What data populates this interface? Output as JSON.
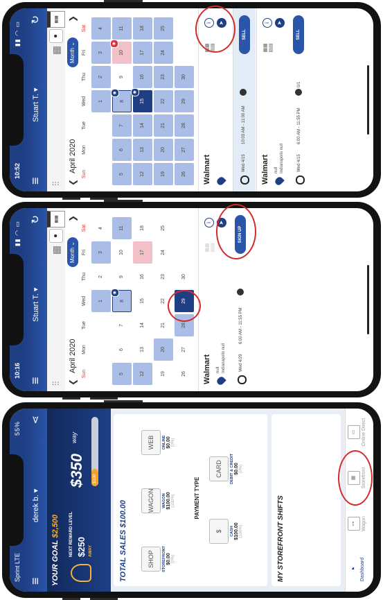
{
  "phone_calendar_sell": {
    "status_time": "10:52",
    "user": "Stuart T. ▾",
    "month_label": "April 2020",
    "view_button": "Month",
    "weekdays": [
      "Sun",
      "Mon",
      "Tue",
      "Wed",
      "Thu",
      "Fri",
      "Sat"
    ],
    "shifts": [
      {
        "store": "Walmart",
        "addr1": "",
        "addr2": "",
        "date": "Wed 4/15",
        "time": "10:03 AM - 11:00 AM",
        "count": "",
        "action": "SELL"
      },
      {
        "store": "Walmart",
        "addr1": "null",
        "addr2": "Indianapolis null",
        "date": "Wed 4/15",
        "time": "6:00 AM - 11:55 PM",
        "count": "0/1",
        "action": "SELL"
      }
    ]
  },
  "phone_calendar_signup": {
    "status_time": "10:16",
    "user": "Stuart T. ▾",
    "month_label": "April 2020",
    "view_button": "Month",
    "weekdays": [
      "Sun",
      "Mon",
      "Tue",
      "Wed",
      "Thu",
      "Fri",
      "Sat"
    ],
    "shift": {
      "store": "Walmart",
      "addr1": "null",
      "addr2": "Indianapolis null",
      "date": "Wed 4/29",
      "time": "6:00 AM - 11:55 PM",
      "count": "",
      "action": "SIGN UP"
    }
  },
  "phone_dashboard": {
    "carrier": "Sprint LTE",
    "battery": "55%",
    "user": "derek b. ▾",
    "goal_label": "YOUR GOAL",
    "goal_amount": "$2,500",
    "next_level_label": "NEXT REWARD LEVEL",
    "next_level_amount": "$250",
    "next_level_sub": "AWAY",
    "current_amount": "$350",
    "brand": "way",
    "progress_label": "$100",
    "progress_fraction": 0.14,
    "total_sales": "TOTAL SALES $100.00",
    "payment_type_label": "PAYMENT TYPE",
    "channels": [
      {
        "label": "STOREFRONT",
        "value": "$0.00",
        "pct": "(0%)",
        "icon": "SHOP"
      },
      {
        "label": "WAGON",
        "value": "$100.00",
        "pct": "(100%)",
        "icon": "WAGON"
      },
      {
        "label": "ONLINE",
        "value": "$0.00",
        "pct": "(0%)",
        "icon": "WEB"
      }
    ],
    "payments": [
      {
        "label": "CASH",
        "value": "$100.00",
        "pct": "(100%)",
        "icon": "$"
      },
      {
        "label": "DEBIT & CREDIT",
        "value": "$0.00",
        "pct": "(0%)",
        "icon": "CARD"
      }
    ],
    "shifts_title": "MY STOREFRONT SHIFTS",
    "tabs": [
      "Dashboard",
      "Wagon",
      "Storefront",
      "Online Direct"
    ]
  }
}
